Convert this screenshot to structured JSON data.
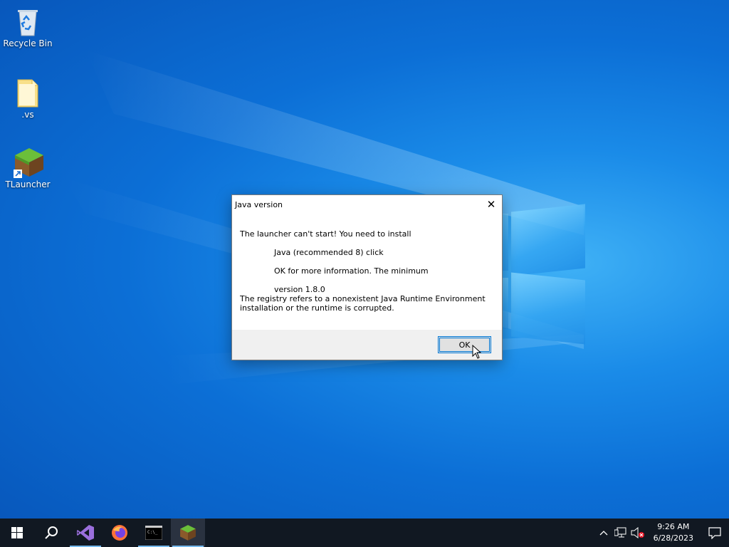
{
  "desktop": {
    "icons": [
      {
        "label": "Recycle Bin",
        "icon": "recycle-bin-icon"
      },
      {
        "label": ".vs",
        "icon": "folder-icon"
      },
      {
        "label": "TLauncher",
        "icon": "tlauncher-icon"
      }
    ]
  },
  "dialog": {
    "title": "Java version",
    "lines": [
      "The launcher can't start! You need to install",
      "Java (recommended 8) click",
      "OK for more information. The minimum",
      "version 1.8.0",
      "The registry refers to a nonexistent Java Runtime Environment",
      "installation or the runtime is corrupted."
    ],
    "ok_label": "OK"
  },
  "taskbar": {
    "apps": [
      "start-icon",
      "search-icon",
      "visual-studio-icon",
      "firefox-icon",
      "terminal-icon",
      "tlauncher-icon"
    ],
    "clock": {
      "time": "9:26 AM",
      "date": "6/28/2023"
    }
  },
  "colors": {
    "accent": "#0078d7",
    "taskbar": "#111822"
  }
}
